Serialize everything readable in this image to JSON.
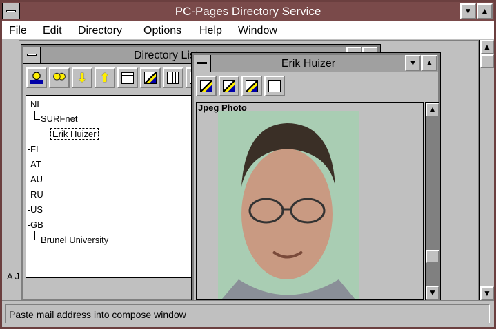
{
  "app": {
    "title": "PC-Pages Directory Service"
  },
  "menu": {
    "items": [
      "File",
      "Edit",
      "Directory",
      "Options",
      "Help",
      "Window"
    ]
  },
  "directory_window": {
    "title": "Directory List",
    "tree": {
      "nodes": [
        {
          "label": "NL"
        },
        {
          "label": "SURFnet"
        },
        {
          "label": "Erik Huizer"
        },
        {
          "label": "FI"
        },
        {
          "label": "AT"
        },
        {
          "label": "AU"
        },
        {
          "label": "RU"
        },
        {
          "label": "US"
        },
        {
          "label": "GB"
        },
        {
          "label": "Brunel University"
        }
      ]
    },
    "bottom_text": "A J"
  },
  "entry_window": {
    "title": "Erik Huizer",
    "attribute_label": "Jpeg Photo"
  },
  "status": {
    "text": "Paste mail address into compose window"
  },
  "icons": {
    "dir_toolbar": [
      "find-person-icon",
      "people-icon",
      "move-down-icon",
      "move-up-icon",
      "search-tree-icon",
      "edit-entry-icon",
      "cards-icon",
      "page-icon"
    ],
    "entry_toolbar": [
      "edit-entry-icon",
      "edit-field-icon",
      "edit-pen-icon",
      "notes-icon"
    ]
  }
}
